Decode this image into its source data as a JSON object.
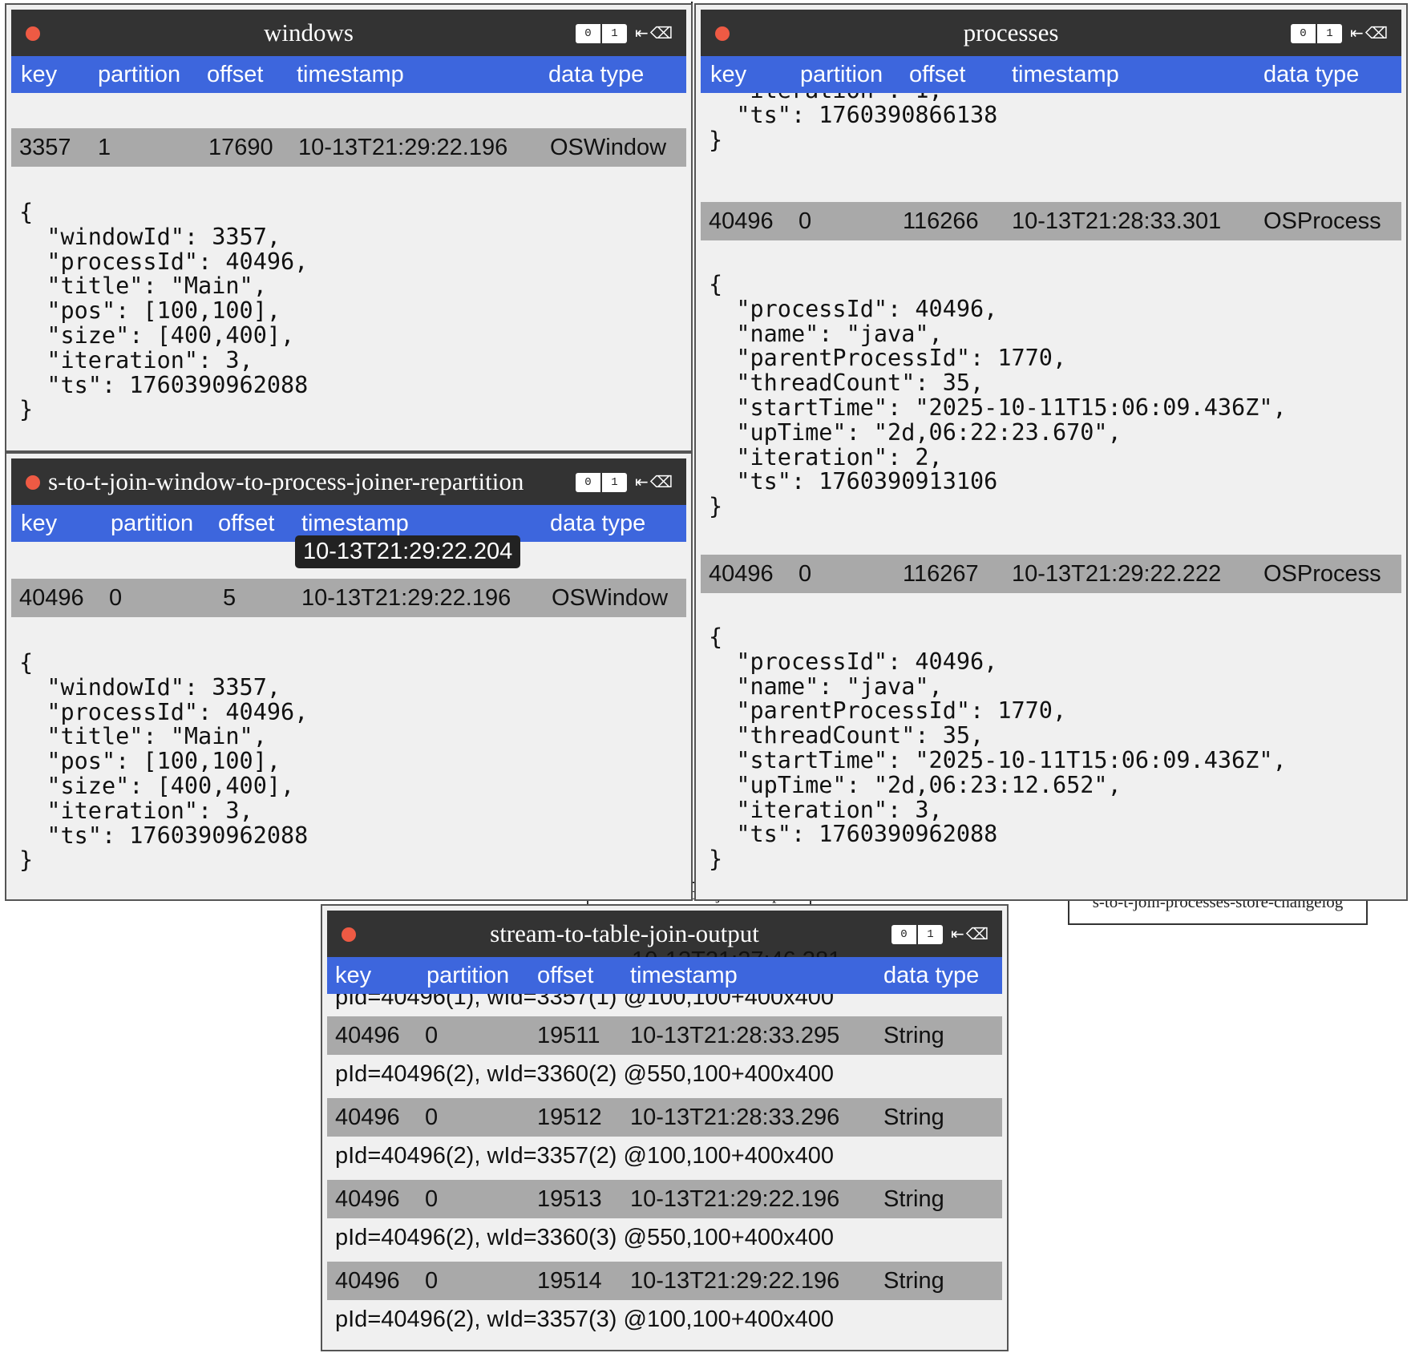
{
  "background": {
    "node_stream_output": "stream-to-table-join-output",
    "node_store_changelog": "s-to-t-join-processes-store-changelog"
  },
  "icons": {
    "close": "close-dot-icon",
    "pin": "pin-icon",
    "clear": "eraser-icon"
  },
  "colors": {
    "header": "#3d66dd",
    "titlebar": "#333333",
    "dot": "#ee5a44",
    "row": "#a9a9a9"
  },
  "toggle": {
    "zero": "0",
    "one": "1"
  },
  "columns": {
    "key": "key",
    "partition": "partition",
    "offset": "offset",
    "timestamp": "timestamp",
    "data_type": "data type"
  },
  "windows": {
    "title": "windows",
    "records": [
      {
        "key": "3357",
        "partition": "1",
        "offset": "17690",
        "timestamp": "10-13T21:29:22.196",
        "type": "OSWindow",
        "value": "{\n  \"windowId\": 3357,\n  \"processId\": 40496,\n  \"title\": \"Main\",\n  \"pos\": [100,100],\n  \"size\": [400,400],\n  \"iteration\": 3,\n  \"ts\": 1760390962088\n}"
      }
    ]
  },
  "processes": {
    "title": "processes",
    "partial_value": "  \"iteration\": 1,\n  \"ts\": 1760390866138\n}",
    "records": [
      {
        "key": "40496",
        "partition": "0",
        "offset": "116266",
        "timestamp": "10-13T21:28:33.301",
        "type": "OSProcess",
        "value": "{\n  \"processId\": 40496,\n  \"name\": \"java\",\n  \"parentProcessId\": 1770,\n  \"threadCount\": 35,\n  \"startTime\": \"2025-10-11T15:06:09.436Z\",\n  \"upTime\": \"2d,06:22:23.670\",\n  \"iteration\": 2,\n  \"ts\": 1760390913106\n}"
      },
      {
        "key": "40496",
        "partition": "0",
        "offset": "116267",
        "timestamp": "10-13T21:29:22.222",
        "type": "OSProcess",
        "value": "{\n  \"processId\": 40496,\n  \"name\": \"java\",\n  \"parentProcessId\": 1770,\n  \"threadCount\": 35,\n  \"startTime\": \"2025-10-11T15:06:09.436Z\",\n  \"upTime\": \"2d,06:23:12.652\",\n  \"iteration\": 3,\n  \"ts\": 1760390962088\n}"
      }
    ]
  },
  "repartition": {
    "title": "s-to-t-join-window-to-process-joiner-repartition",
    "tooltip": "10-13T21:29:22.204",
    "records": [
      {
        "key": "40496",
        "partition": "0",
        "offset": "5",
        "timestamp": "10-13T21:29:22.196",
        "type": "OSWindow",
        "value": "{\n  \"windowId\": 3357,\n  \"processId\": 40496,\n  \"title\": \"Main\",\n  \"pos\": [100,100],\n  \"size\": [400,400],\n  \"iteration\": 3,\n  \"ts\": 1760390962088\n}"
      }
    ]
  },
  "output": {
    "title": "stream-to-table-join-output",
    "tooltip": "10-13T21:27:46.381",
    "partial_value": "pId=40496(1), wId=3357(1) @100,100+400x400",
    "records": [
      {
        "key": "40496",
        "partition": "0",
        "offset": "19511",
        "timestamp": "10-13T21:28:33.295",
        "type": "String",
        "value": "pId=40496(2), wId=3360(2) @550,100+400x400"
      },
      {
        "key": "40496",
        "partition": "0",
        "offset": "19512",
        "timestamp": "10-13T21:28:33.296",
        "type": "String",
        "value": "pId=40496(2), wId=3357(2) @100,100+400x400"
      },
      {
        "key": "40496",
        "partition": "0",
        "offset": "19513",
        "timestamp": "10-13T21:29:22.196",
        "type": "String",
        "value": "pId=40496(2), wId=3360(3) @550,100+400x400"
      },
      {
        "key": "40496",
        "partition": "0",
        "offset": "19514",
        "timestamp": "10-13T21:29:22.196",
        "type": "String",
        "value": "pId=40496(2), wId=3357(3) @100,100+400x400"
      }
    ]
  }
}
